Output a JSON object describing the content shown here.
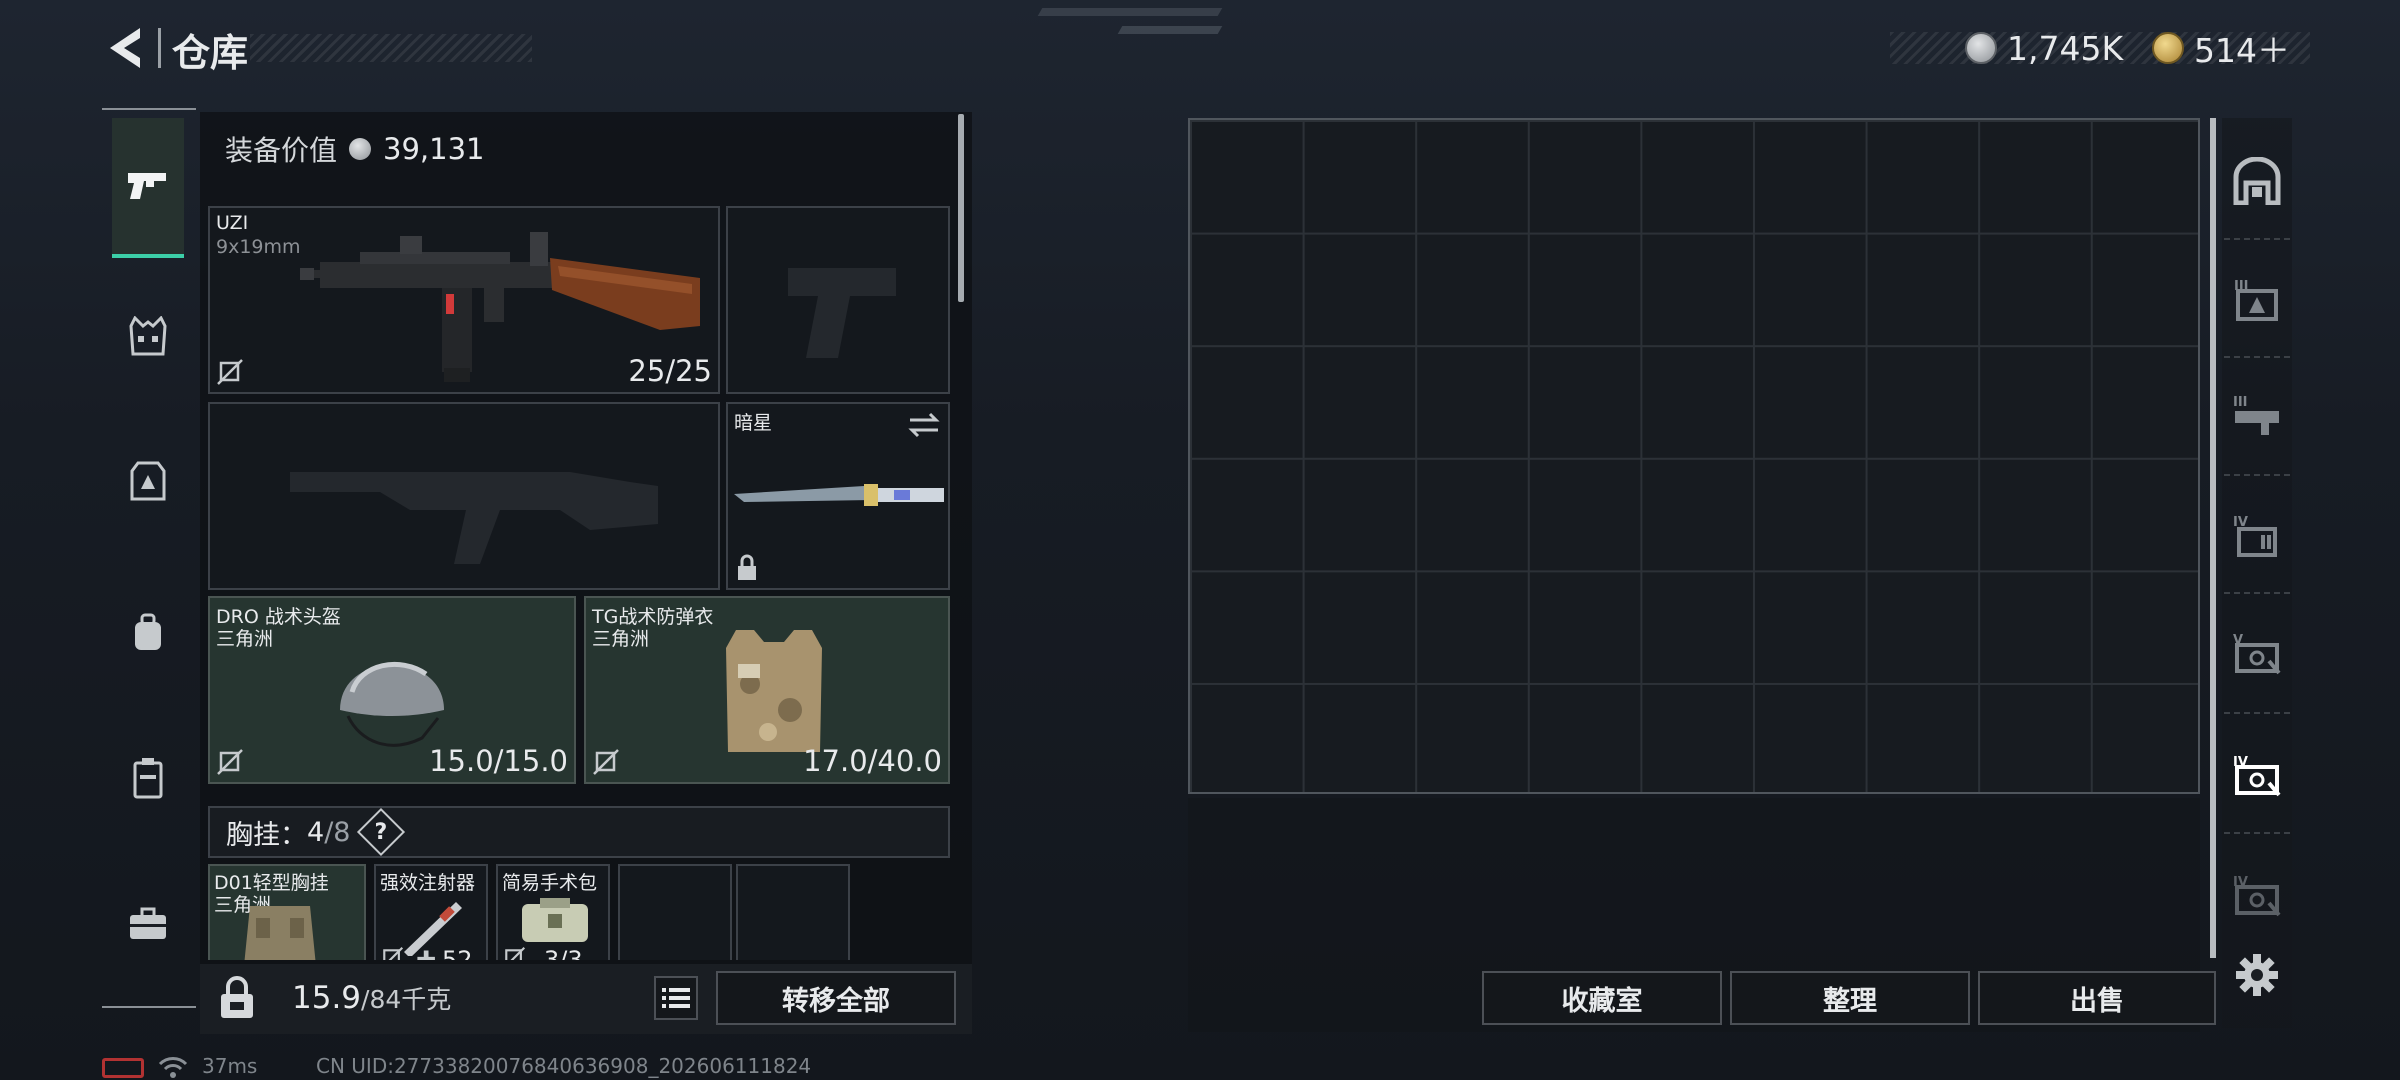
{
  "header": {
    "title": "仓库",
    "currency1": "1,745K",
    "currency2": "514＋"
  },
  "equip": {
    "label": "装备价值",
    "value": "39,131"
  },
  "slots": {
    "primary": {
      "name": "UZI",
      "caliber": "9x19mm",
      "ammo": "25/25"
    },
    "melee": {
      "name": "暗星"
    },
    "helmet": {
      "name": "DRO 战术头盔",
      "brand": "三角洲",
      "durability": "15.0/15.0"
    },
    "armor": {
      "name": "TG战术防弹衣",
      "brand": "三角洲",
      "durability": "17.0/40.0"
    }
  },
  "chest": {
    "label": "胸挂：",
    "count": "4",
    "capacity": "/8",
    "help": "?",
    "items": [
      {
        "name": "D01轻型胸挂",
        "brand": "三角洲"
      },
      {
        "name": "强效注射器",
        "qty": "52"
      },
      {
        "name": "简易手术包",
        "qty": "3/3"
      }
    ]
  },
  "bottom": {
    "weight": "15.9",
    "weight_max": "/84千克",
    "transfer": "转移全部"
  },
  "actions": {
    "collection": "收藏室",
    "sort": "整理",
    "sell": "出售"
  },
  "status": {
    "ping": "37ms",
    "uid": "CN UID:27733820076840636908_202606111824"
  },
  "colors": {
    "accent": "#3ccfa8",
    "slot_green": "#263530",
    "panel": "#0e1115"
  }
}
